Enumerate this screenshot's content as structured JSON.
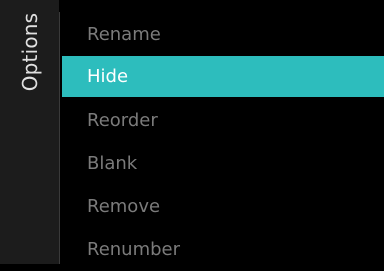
{
  "sidebar": {
    "title": "Options"
  },
  "menu": {
    "items": [
      {
        "label": "Rename"
      },
      {
        "label": "Hide",
        "selected": true
      },
      {
        "label": "Reorder"
      },
      {
        "label": "Blank"
      },
      {
        "label": "Remove"
      },
      {
        "label": "Renumber"
      }
    ]
  },
  "colors": {
    "background": "#000000",
    "sidebar": "#1c1c1c",
    "highlight": "#2dbdbd",
    "text_selected": "#ffffff",
    "text_dim": "#7b7b7b"
  }
}
